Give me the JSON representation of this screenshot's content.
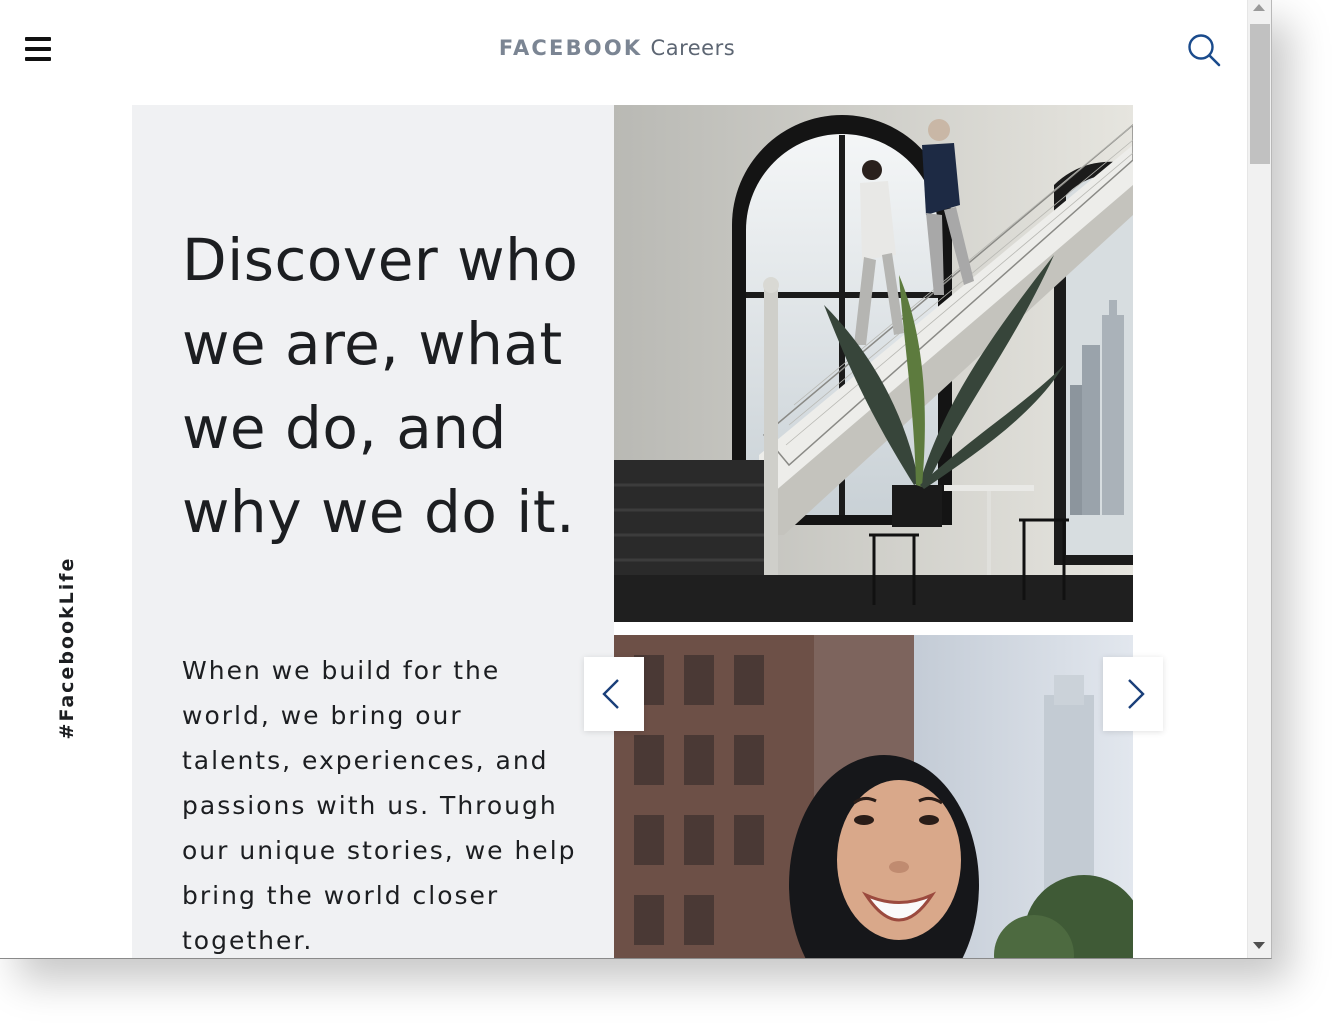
{
  "header": {
    "brand_main": "FACEBOOK",
    "brand_sub": "Careers",
    "menu_icon": "hamburger-menu-icon",
    "search_icon": "search-icon"
  },
  "side": {
    "hashtag": "#FacebookLife"
  },
  "hero": {
    "headline": "Discover who we are, what we do, and why we do it.",
    "body": "When we build for the world, we bring our talents, experiences, and passions with us. Through our unique stories, we help bring the world closer together."
  },
  "carousel": {
    "prev_icon": "chevron-left-icon",
    "next_icon": "chevron-right-icon",
    "images": [
      "office-staircase-photo",
      "smiling-woman-photo"
    ]
  },
  "colors": {
    "panel_bg": "#f0f1f3",
    "text": "#1c1e21",
    "brand_gray": "#7b8593",
    "accent_blue": "#1a4b8c"
  }
}
